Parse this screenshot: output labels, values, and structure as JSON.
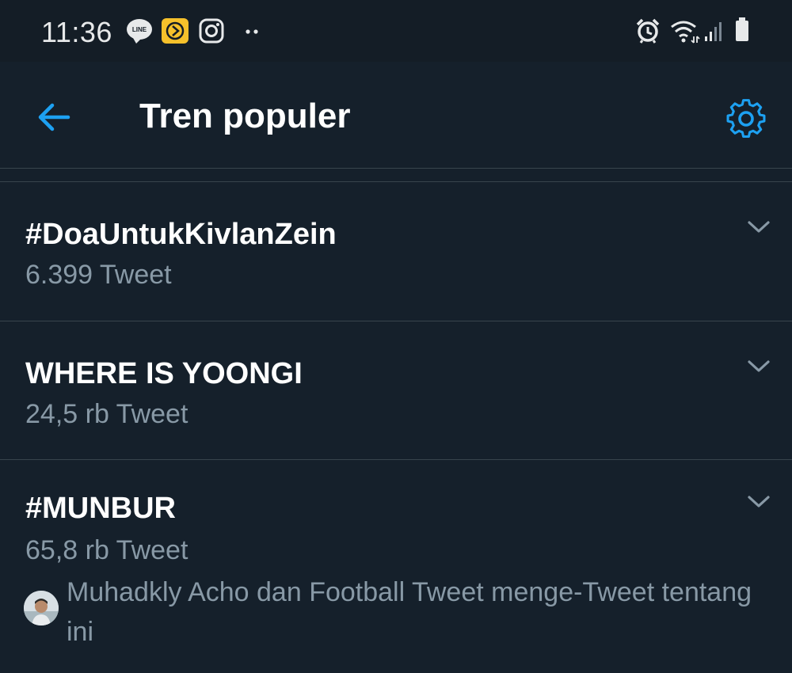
{
  "status_bar": {
    "time": "11:36",
    "line_badge_text": "LINE",
    "left_icons": [
      "line-icon",
      "yellow-app-icon",
      "instagram-icon",
      "more-notifications-icon"
    ],
    "right_icons": [
      "alarm-icon",
      "wifi-icon",
      "signal-icon",
      "battery-icon"
    ]
  },
  "header": {
    "title": "Tren populer",
    "back_icon": "arrow-left-icon",
    "settings_icon": "gear-icon",
    "accent_color": "#1da1f2"
  },
  "trends": [
    {
      "name": "#DoaUntukKivlanZein",
      "count": "6.399 Tweet"
    },
    {
      "name": "WHERE IS YOONGI",
      "count": "24,5 rb Tweet"
    },
    {
      "name": "#MUNBUR",
      "count": "65,8 rb Tweet",
      "context": "Muhadkly Acho dan Football Tweet menge-Tweet tentang ini"
    }
  ],
  "colors": {
    "background": "#15202b",
    "status_bar": "#141d26",
    "secondary_text": "#8899a6",
    "divider": "#38444d"
  }
}
